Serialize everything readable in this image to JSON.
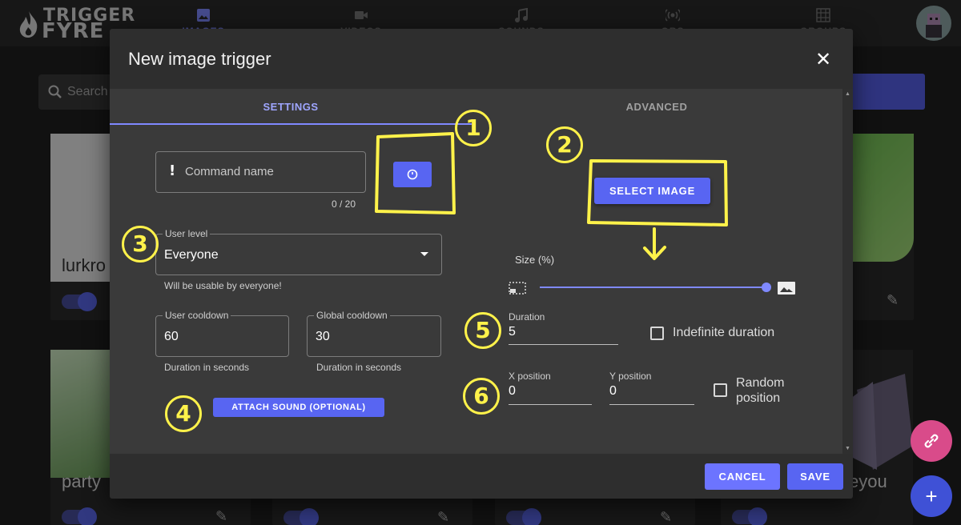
{
  "app": {
    "logo_line1": "TRIGGER",
    "logo_line2": "FYRE",
    "nav": [
      {
        "label": "IMAGES",
        "icon": "image-icon",
        "active": true
      },
      {
        "label": "VIDEOS",
        "icon": "video-icon",
        "active": false
      },
      {
        "label": "SOUNDS",
        "icon": "music-icon",
        "active": false
      },
      {
        "label": "OBS",
        "icon": "broadcast-icon",
        "active": false
      },
      {
        "label": "GROUPS",
        "icon": "grid-icon",
        "active": false
      }
    ],
    "search_placeholder": "Search",
    "cards": [
      "lurkro",
      "party",
      "eyou"
    ]
  },
  "dialog": {
    "title": "New image trigger",
    "close_icon": "close-icon",
    "tabs": [
      {
        "label": "SETTINGS",
        "active": true
      },
      {
        "label": "ADVANCED",
        "active": false
      }
    ],
    "command_name": {
      "placeholder": "Command name",
      "counter": "0 / 20",
      "value": ""
    },
    "timer_button_icon": "timer-icon",
    "user_level": {
      "label": "User level",
      "value": "Everyone",
      "helper": "Will be usable by everyone!"
    },
    "user_cooldown": {
      "label": "User cooldown",
      "value": "60",
      "helper": "Duration in seconds"
    },
    "global_cooldown": {
      "label": "Global cooldown",
      "value": "30",
      "helper": "Duration in seconds"
    },
    "attach_sound_label": "ATTACH SOUND (OPTIONAL)",
    "select_image_label": "SELECT IMAGE",
    "size": {
      "label": "Size (%)",
      "value_fraction": 1.0
    },
    "duration": {
      "label": "Duration",
      "value": "5"
    },
    "indefinite_duration_label": "Indefinite duration",
    "x_position": {
      "label": "X position",
      "value": "0"
    },
    "y_position": {
      "label": "Y position",
      "value": "0"
    },
    "random_position_label": "Random position",
    "cancel_label": "CANCEL",
    "save_label": "SAVE"
  },
  "annotations": [
    "1",
    "2",
    "3",
    "4",
    "5",
    "6"
  ],
  "colors": {
    "accent": "#5865f2",
    "accent_light": "#7f89ff",
    "annotation": "#fff24a",
    "link_fab": "#d94b8a"
  }
}
